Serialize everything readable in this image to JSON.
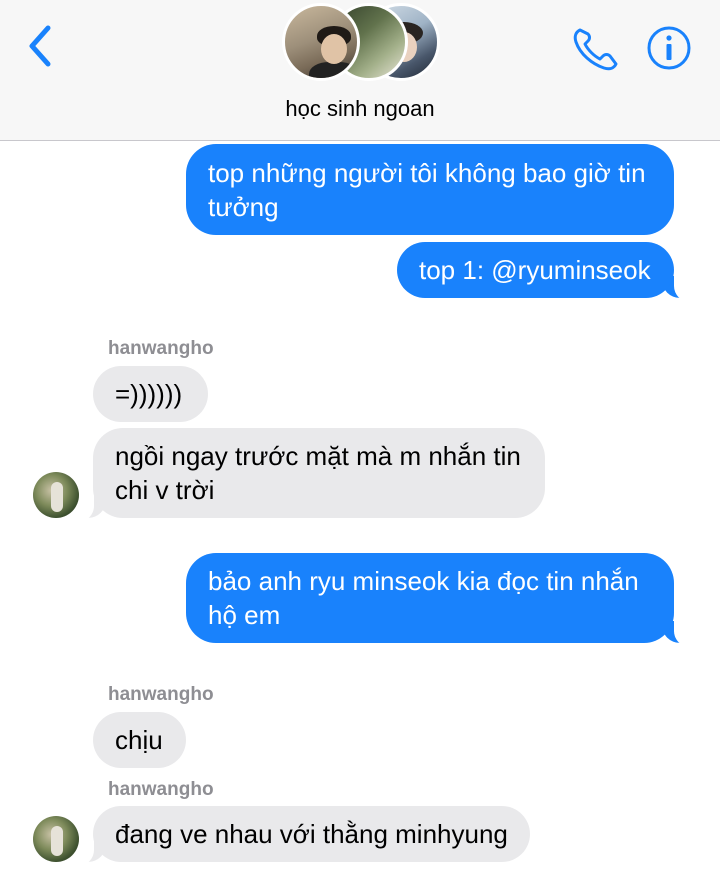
{
  "header": {
    "group_name": "học sinh ngoan",
    "back_icon": "chevron-left-icon",
    "call_icon": "phone-icon",
    "info_icon": "info-icon",
    "accent_color": "#1982fc"
  },
  "messages": [
    {
      "direction": "outgoing",
      "text": "top những người tôi không bao giờ tin tưởng"
    },
    {
      "direction": "outgoing",
      "text": "top 1: @ryuminseok"
    },
    {
      "direction": "incoming",
      "sender": "hanwangho",
      "text": "=))))))"
    },
    {
      "direction": "incoming",
      "text": "ngồi ngay trước mặt mà m nhắn tin chi v trời"
    },
    {
      "direction": "outgoing",
      "text": "bảo anh ryu minseok kia đọc tin nhắn hộ em"
    },
    {
      "direction": "incoming",
      "sender": "hanwangho",
      "text": "chịu"
    },
    {
      "direction": "incoming",
      "sender": "hanwangho",
      "text": "đang ve nhau với thằng minhyung"
    }
  ],
  "colors": {
    "outgoing_bubble": "#1982fc",
    "incoming_bubble": "#e9e9eb",
    "sender_label": "#8e8e93"
  }
}
